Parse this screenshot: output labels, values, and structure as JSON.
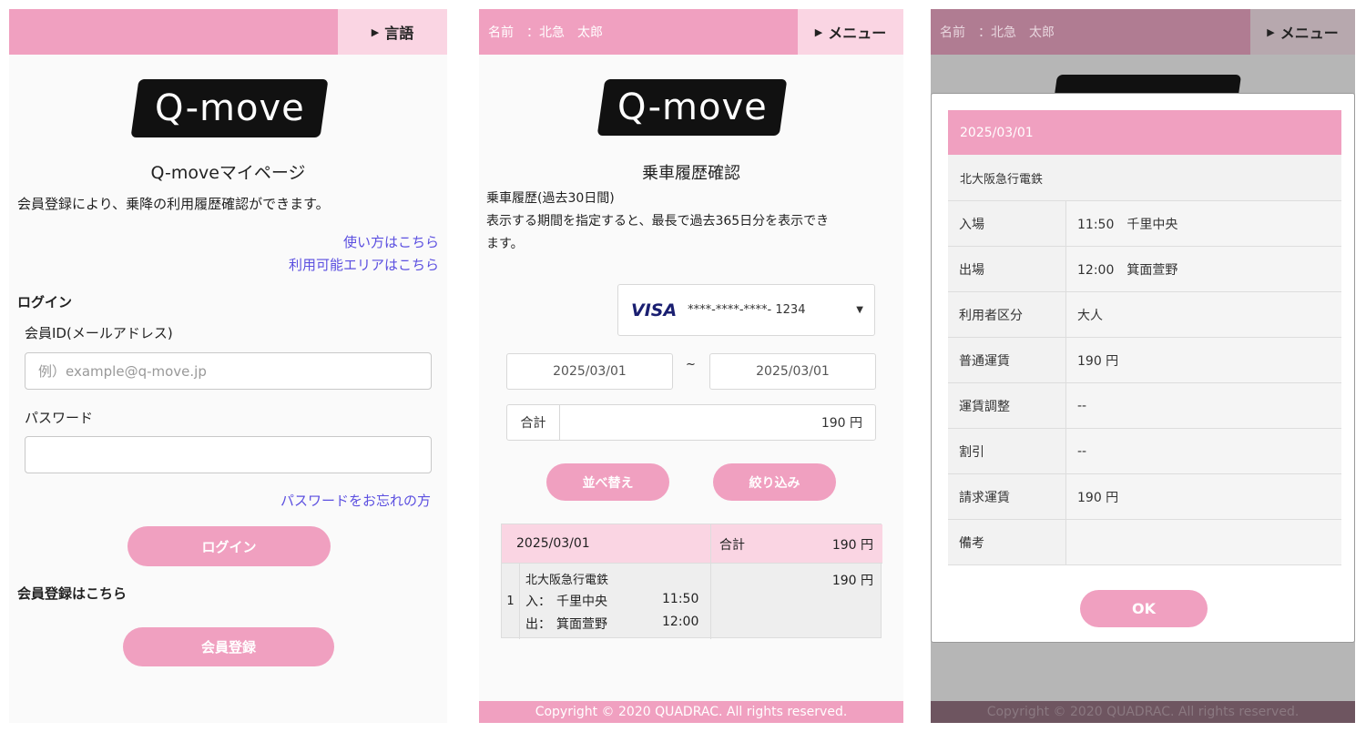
{
  "login": {
    "lang_button": "言語",
    "logo_text": "Q-move",
    "title": "Q-moveマイページ",
    "description": "会員登録により、乗降の利用履歴確認ができます。",
    "link_howto": "使い方はこちら",
    "link_area": "利用可能エリアはこちら",
    "section_login": "ログイン",
    "label_id": "会員ID(メールアドレス)",
    "placeholder_id": "例）example@q-move.jp",
    "label_password": "パスワード",
    "password_value": "",
    "link_forgot": "パスワードをお忘れの方",
    "login_button": "ログイン",
    "section_register": "会員登録はこちら",
    "register_button": "会員登録"
  },
  "history": {
    "user_label": "名前　：北急　太郎",
    "menu_button": "メニュー",
    "logo_text": "Q-move",
    "title": "乗車履歴確認",
    "desc_line1": "乗車履歴(過去30日間)",
    "desc_line2": "表示する期間を指定すると、最長で過去365日分を表示でき",
    "desc_line3": "ます。",
    "card_brand": "VISA",
    "card_number": "****-****-****- 1234",
    "date_from": "2025/03/01",
    "date_sep": "~",
    "date_to": "2025/03/01",
    "total_label": "合計",
    "total_value": "190 円",
    "sort_button": "並べ替え",
    "filter_button": "絞り込み",
    "table": {
      "date": "2025/03/01",
      "total_label": "合計",
      "total_value": "190 円",
      "row_no": "1",
      "operator": "北大阪急行電鉄",
      "in_label": "入：",
      "in_station": "千里中央",
      "in_time": "11:50",
      "out_label": "出：",
      "out_station": "箕面萱野",
      "out_time": "12:00",
      "fare": "190 円"
    },
    "footer": "Copyright © 2020 QUADRAC. All rights reserved."
  },
  "detail": {
    "user_label": "名前　：北急　太郎",
    "menu_button": "メニュー",
    "date": "2025/03/01",
    "operator": "北大阪急行電鉄",
    "rows": [
      {
        "k": "入場",
        "v": "11:50　千里中央"
      },
      {
        "k": "出場",
        "v": "12:00　箕面萱野"
      },
      {
        "k": "利用者区分",
        "v": "大人"
      },
      {
        "k": "普通運賃",
        "v": "190 円"
      },
      {
        "k": "運賃調整",
        "v": "--"
      },
      {
        "k": "割引",
        "v": "--"
      },
      {
        "k": "請求運賃",
        "v": "190 円"
      },
      {
        "k": "備考",
        "v": ""
      }
    ],
    "ok_button": "OK",
    "footer": "Copyright © 2020 QUADRAC. All rights reserved."
  },
  "colors": {
    "accent_pink": "#f0a0c0",
    "light_pink": "#fad5e3",
    "link_blue": "#5b4fe0"
  }
}
